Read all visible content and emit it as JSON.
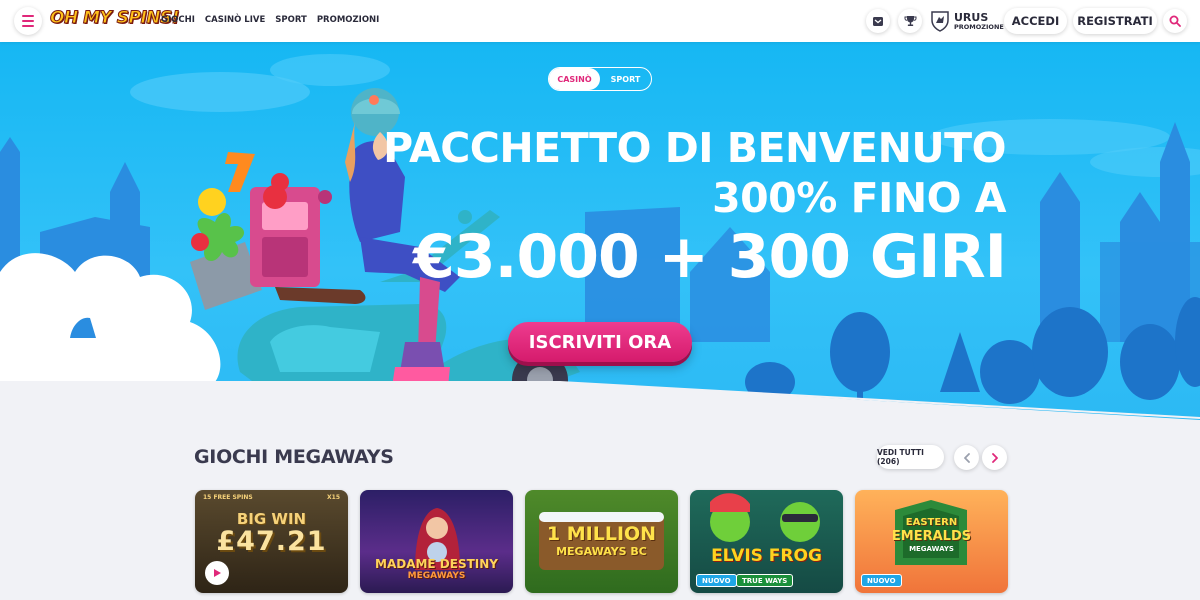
{
  "header": {
    "logo_text": "OH MY SPINS!",
    "nav": [
      "GIOCHI",
      "CASINÒ LIVE",
      "SPORT",
      "PROMOZIONI"
    ],
    "promo_name": "URUS",
    "promo_sub": "PROMOZIONE",
    "login_label": "ACCEDI",
    "register_label": "REGISTRATI"
  },
  "hero": {
    "toggle": [
      "CASINÒ",
      "SPORT"
    ],
    "line1": "PACCHETTO DI BENVENUTO",
    "line2": "300% FINO A",
    "line3": "€3.000 + 300 GIRI",
    "cta_label": "ISCRIVITI ORA"
  },
  "section": {
    "title": "GIOCHI MEGAWAYS",
    "see_all_label": "VEDI TUTTI (206)"
  },
  "games": [
    {
      "title": "BIG WIN",
      "line2": "£47.21",
      "top": "15 FREE SPINS",
      "mult": "X15"
    },
    {
      "title": "MADAME DESTINY",
      "line2": "MEGAWAYS"
    },
    {
      "title": "1 MILLION",
      "line2": "MEGAWAYS BC"
    },
    {
      "title": "ELVIS FROG",
      "line2": "TRUE WAYS",
      "badge": "NUOVO"
    },
    {
      "title": "EASTERN",
      "line2": "EMERALDS",
      "line3": "MEGAWAYS",
      "badge": "NUOVO"
    }
  ],
  "colors": {
    "accent": "#e0287a",
    "hero_sky": "#22bbf5",
    "page_bg": "#f1f2f6"
  }
}
